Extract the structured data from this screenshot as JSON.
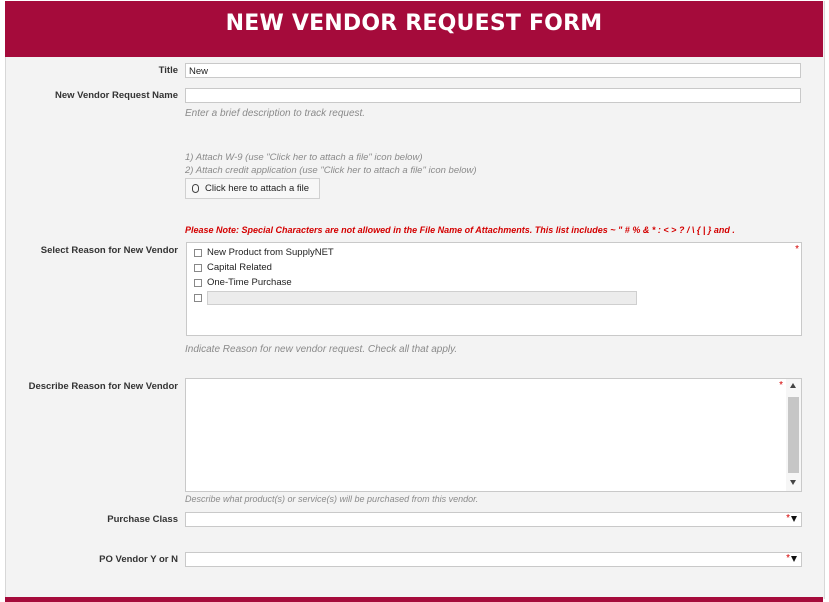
{
  "header": {
    "title": "NEW VENDOR REQUEST FORM"
  },
  "fields": {
    "title": {
      "label": "Title",
      "value": "New"
    },
    "request_name": {
      "label": "New Vendor Request Name",
      "value": "",
      "hint": "Enter a brief description to track request."
    },
    "attachments": {
      "instruction_1": "1) Attach W-9 (use \"Click her to attach a file\" icon below)",
      "instruction_2": "2) Attach credit application (use \"Click her to attach a file\" icon below)",
      "button_label": "Click here to attach a file",
      "note": "Please Note: Special Characters are not allowed in the File Name of Attachments. This list includes  ~ \" # % & * : < > ? / \\ { | } and ."
    },
    "reason": {
      "label": "Select Reason for New Vendor",
      "required_mark": "*",
      "options": [
        "New Product from SupplyNET",
        "Capital Related",
        "One-Time Purchase"
      ],
      "other_value": "",
      "hint": "Indicate Reason for new vendor request. Check all that apply."
    },
    "describe": {
      "label": "Describe Reason for New Vendor",
      "required_mark": "*",
      "value": "",
      "hint": "Describe what product(s) or service(s) will be purchased from this vendor."
    },
    "purchase_class": {
      "label": "Purchase Class",
      "required_mark": "*",
      "value": ""
    },
    "po_vendor": {
      "label": "PO Vendor Y or N",
      "required_mark": "*",
      "value": ""
    }
  },
  "colors": {
    "brand": "#a50b3b",
    "required": "#d40000",
    "background": "#f3f3f3"
  }
}
